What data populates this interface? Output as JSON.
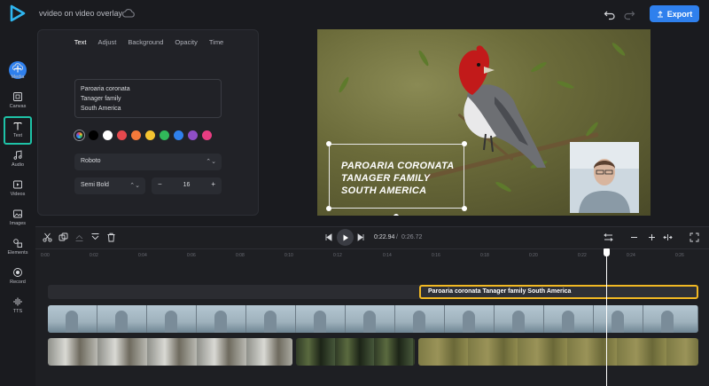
{
  "app": {
    "project_title": "vvideo on video overlay",
    "export_label": "Export",
    "accent": "#2f80ed"
  },
  "sidebar": {
    "items": [
      {
        "label": "Media",
        "icon": "cloud-upload-icon"
      },
      {
        "label": "Canvas",
        "icon": "canvas-icon"
      },
      {
        "label": "Text",
        "icon": "text-icon",
        "active": true
      },
      {
        "label": "Audio",
        "icon": "music-note-icon"
      },
      {
        "label": "Videos",
        "icon": "video-icon"
      },
      {
        "label": "Images",
        "icon": "image-icon"
      },
      {
        "label": "Elements",
        "icon": "shapes-icon"
      },
      {
        "label": "Record",
        "icon": "record-icon"
      },
      {
        "label": "TTS",
        "icon": "soundwave-icon"
      }
    ]
  },
  "panel": {
    "tabs": [
      "Text",
      "Adjust",
      "Background",
      "Opacity",
      "Time"
    ],
    "active_tab": "Text",
    "text_lines": [
      "Paroaria coronata",
      "Tanager family",
      "South America"
    ],
    "colors": [
      "#000000",
      "#ffffff",
      "#e5484d",
      "#f5793a",
      "#f5c431",
      "#31b95a",
      "#2f80ed",
      "#8e4ec6",
      "#e93d82"
    ],
    "font": "Roboto",
    "weight": "Semi Bold",
    "size": "16"
  },
  "preview": {
    "overlay_lines": [
      "PAROARIA CORONATA",
      "TANAGER FAMILY",
      "SOUTH AMERICA"
    ]
  },
  "timeline": {
    "current_time": "0:22.94",
    "separator": "/",
    "total_time": "0:26.72",
    "ruler_labels": [
      "0:00",
      "0:02",
      "0:04",
      "0:06",
      "0:08",
      "0:10",
      "0:12",
      "0:14",
      "0:16",
      "0:18",
      "0:20",
      "0:22",
      "0:24",
      "0:26"
    ],
    "text_clip_label": "Paroaria coronata Tanager family South America"
  }
}
